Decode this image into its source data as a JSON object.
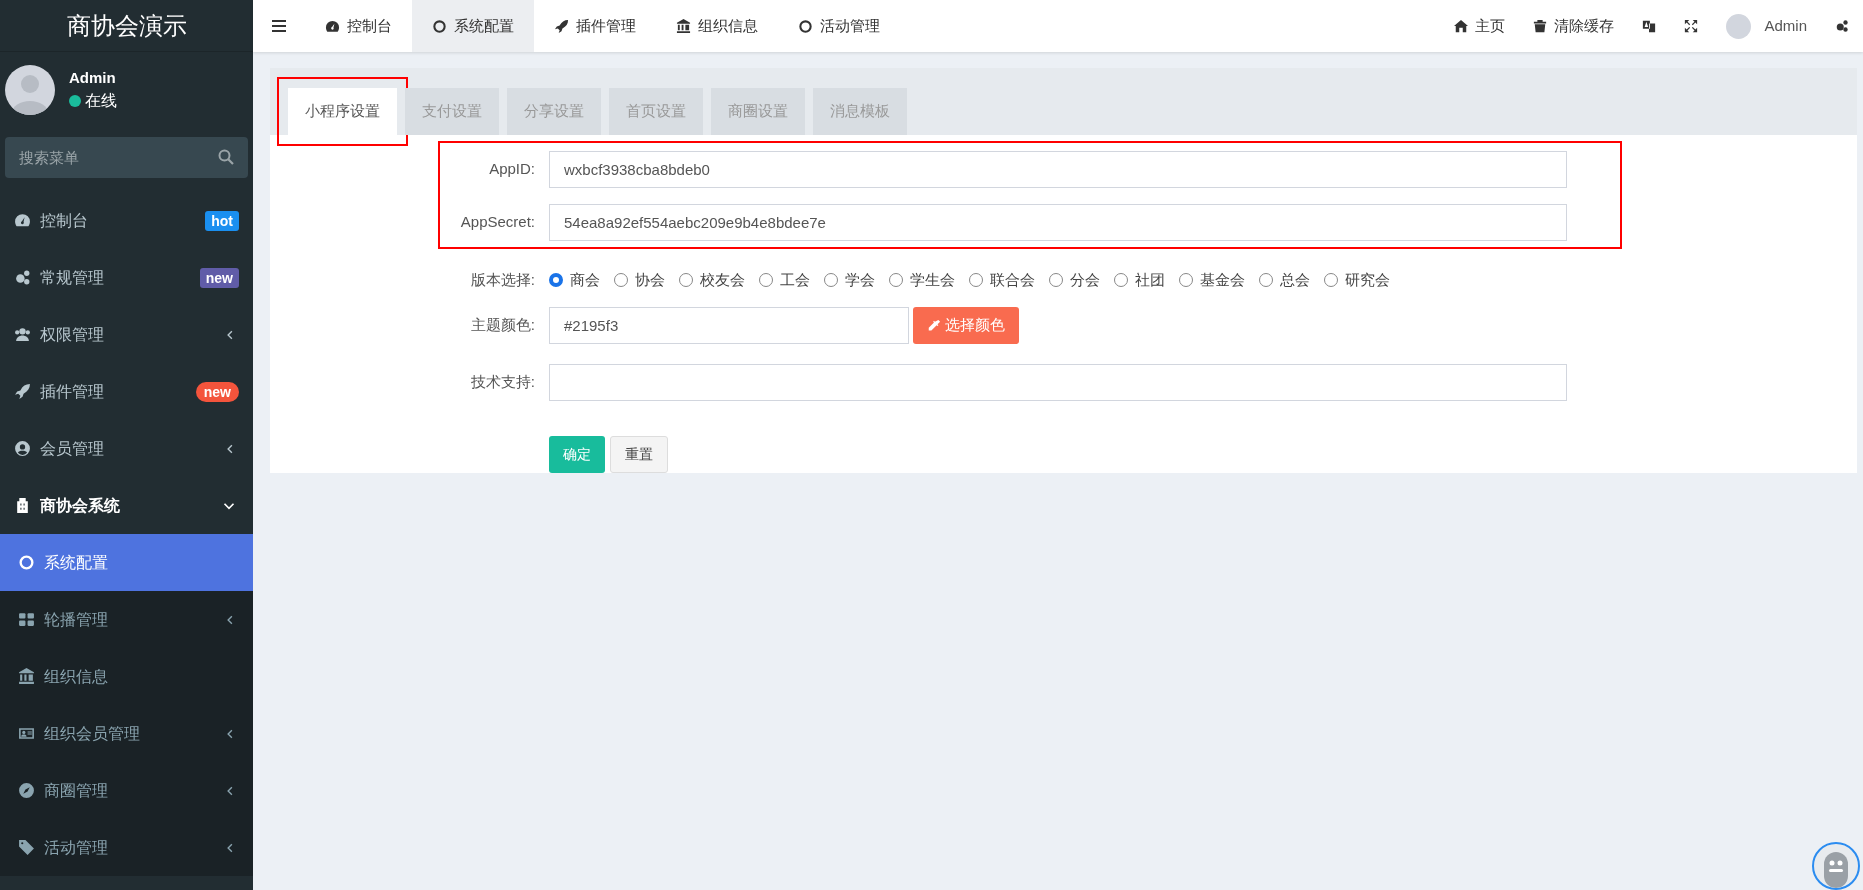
{
  "brand": "商协会演示",
  "user": {
    "name": "Admin",
    "status": "在线",
    "online": true
  },
  "search": {
    "placeholder": "搜索菜单"
  },
  "sidebar": {
    "items": [
      {
        "label": "控制台",
        "badge": {
          "text": "hot",
          "color": "#1a8ff0",
          "pill": false
        },
        "has_children": false,
        "expanded": false,
        "selected": false
      },
      {
        "label": "常规管理",
        "badge": {
          "text": "new",
          "color": "#605ca8",
          "pill": false
        },
        "has_children": false,
        "expanded": false,
        "selected": false
      },
      {
        "label": "权限管理",
        "has_children": true,
        "expanded": false,
        "selected": false
      },
      {
        "label": "插件管理",
        "badge": {
          "text": "new",
          "color": "#f4543c",
          "pill": true
        },
        "has_children": false,
        "expanded": false,
        "selected": false
      },
      {
        "label": "会员管理",
        "has_children": true,
        "expanded": false,
        "selected": false
      },
      {
        "label": "商协会系统",
        "has_children": true,
        "expanded": true,
        "selected": false,
        "children": [
          {
            "label": "系统配置",
            "has_children": false,
            "expanded": false,
            "selected": true
          },
          {
            "label": "轮播管理",
            "has_children": true,
            "expanded": false,
            "selected": false
          },
          {
            "label": "组织信息",
            "has_children": false,
            "expanded": false,
            "selected": false
          },
          {
            "label": "组织会员管理",
            "has_children": true,
            "expanded": false,
            "selected": false
          },
          {
            "label": "商圈管理",
            "has_children": true,
            "expanded": false,
            "selected": false
          },
          {
            "label": "活动管理",
            "has_children": true,
            "expanded": false,
            "selected": false
          }
        ]
      }
    ]
  },
  "top_nav": {
    "tabs": [
      {
        "label": "控制台",
        "selected": false
      },
      {
        "label": "系统配置",
        "selected": true
      },
      {
        "label": "插件管理",
        "selected": false
      },
      {
        "label": "组织信息",
        "selected": false
      },
      {
        "label": "活动管理",
        "selected": false
      }
    ],
    "home": "主页",
    "clear_cache": "清除缓存",
    "user_name": "Admin"
  },
  "settings_tabs": [
    {
      "label": "小程序设置",
      "selected": true,
      "highlighted": true
    },
    {
      "label": "支付设置",
      "selected": false,
      "highlighted": false
    },
    {
      "label": "分享设置",
      "selected": false,
      "highlighted": false
    },
    {
      "label": "首页设置",
      "selected": false,
      "highlighted": false
    },
    {
      "label": "商圈设置",
      "selected": false,
      "highlighted": false
    },
    {
      "label": "消息模板",
      "selected": false,
      "highlighted": false
    }
  ],
  "form": {
    "credentials_highlighted": true,
    "app_id": {
      "label": "AppID:",
      "value": "wxbcf3938cba8bdeb0"
    },
    "app_secret": {
      "label": "AppSecret:",
      "value": "54ea8a92ef554aebc209e9b4e8bdee7e"
    },
    "version": {
      "label": "版本选择:",
      "options": [
        {
          "label": "商会",
          "selected": true
        },
        {
          "label": "协会",
          "selected": false
        },
        {
          "label": "校友会",
          "selected": false
        },
        {
          "label": "工会",
          "selected": false
        },
        {
          "label": "学会",
          "selected": false
        },
        {
          "label": "学生会",
          "selected": false
        },
        {
          "label": "联合会",
          "selected": false
        },
        {
          "label": "分会",
          "selected": false
        },
        {
          "label": "社团",
          "selected": false
        },
        {
          "label": "基金会",
          "selected": false
        },
        {
          "label": "总会",
          "selected": false
        },
        {
          "label": "研究会",
          "selected": false
        }
      ]
    },
    "theme_color": {
      "label": "主题颜色:",
      "value": "#2195f3",
      "button": "选择颜色"
    },
    "tech_support": {
      "label": "技术支持:"
    },
    "buttons": {
      "submit": "确定",
      "reset": "重置"
    }
  }
}
